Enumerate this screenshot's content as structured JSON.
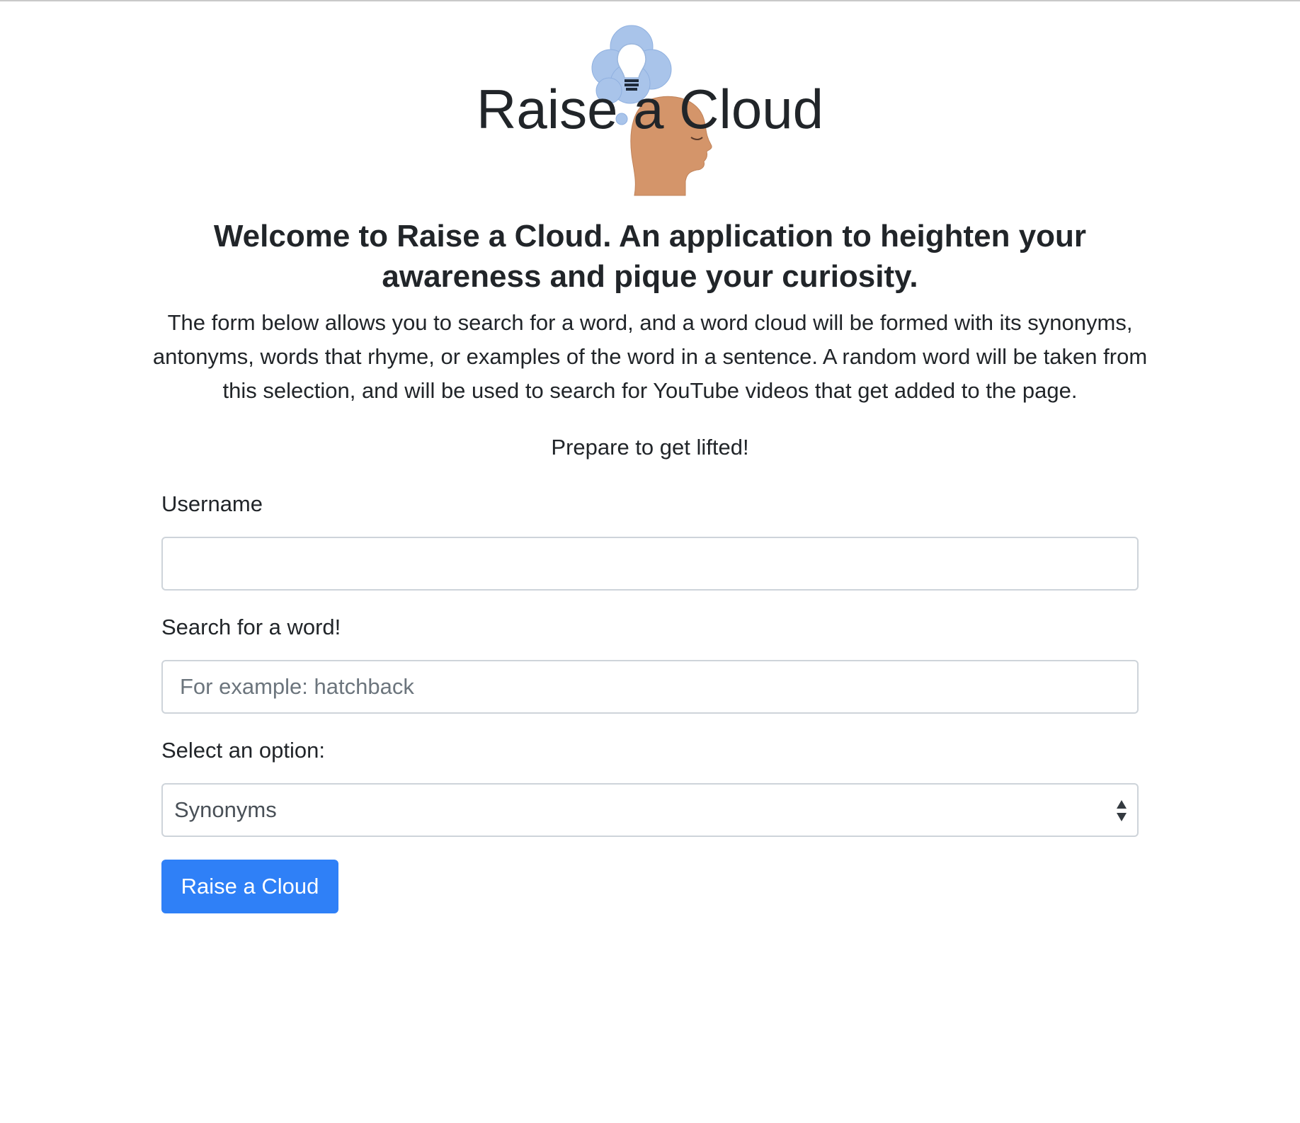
{
  "header": {
    "title": "Raise a Cloud"
  },
  "intro": {
    "heading": "Welcome to Raise a Cloud. An application to heighten your awareness and pique your curiosity.",
    "description": "The form below allows you to search for a word, and a word cloud will be formed with its synonyms, antonyms, words that rhyme, or examples of the word in a sentence. A random word will be taken from this selection, and will be used to search for YouTube videos that get added to the page.",
    "tagline": "Prepare to get lifted!"
  },
  "form": {
    "username": {
      "label": "Username",
      "value": "",
      "placeholder": ""
    },
    "search": {
      "label": "Search for a word!",
      "value": "",
      "placeholder": "For example: hatchback"
    },
    "option": {
      "label": "Select an option:",
      "selected": "Synonyms"
    },
    "submit_label": "Raise a Cloud"
  },
  "colors": {
    "primary_button": "#2f80f7",
    "text": "#212529",
    "input_border": "#ced4da",
    "logo_cloud": "#a9c4ea",
    "logo_head": "#d4956a"
  },
  "icons": {
    "logo": "head-with-lightbulb-cloud-icon",
    "select_arrows": "up-down-arrows-icon"
  }
}
